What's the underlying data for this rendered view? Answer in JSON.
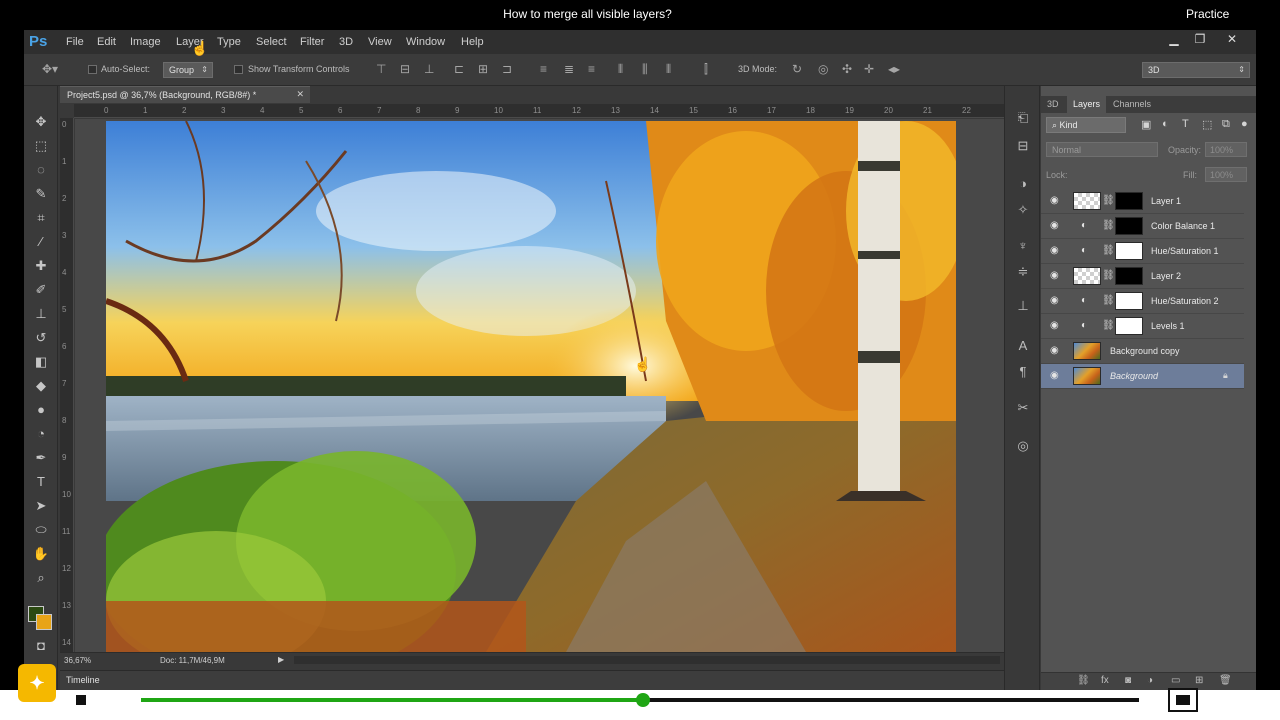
{
  "caption": {
    "title": "How to merge all visible layers?",
    "mode": "Practice"
  },
  "app": {
    "logo": "Ps",
    "menus": [
      "File",
      "Edit",
      "Image",
      "Layer",
      "Type",
      "Select",
      "Filter",
      "3D",
      "View",
      "Window",
      "Help"
    ],
    "window_controls": {
      "minimize": "▁",
      "restore": "❐",
      "close": "✕"
    }
  },
  "options": {
    "auto_select_label": "Auto-Select:",
    "auto_select_value": "Group",
    "show_transform_label": "Show Transform Controls",
    "mode_3d_label": "3D Mode:",
    "workspace_value": "3D"
  },
  "document": {
    "tab_title": "Project5.psd @ 36,7% (Background, RGB/8#) *",
    "zoom": "36,67%",
    "doc_size": "Doc: 11,7M/46,9M",
    "ruler_top_ticks": [
      "0",
      "1",
      "2",
      "3",
      "4",
      "5",
      "6",
      "7",
      "8",
      "9",
      "10",
      "11",
      "12",
      "13",
      "14",
      "15",
      "16",
      "17",
      "18",
      "19",
      "20",
      "21",
      "22"
    ],
    "ruler_left_ticks": [
      "0",
      "1",
      "2",
      "3",
      "4",
      "5",
      "6",
      "7",
      "8",
      "9",
      "10",
      "11",
      "12",
      "13",
      "14"
    ]
  },
  "timeline": {
    "label": "Timeline"
  },
  "panel": {
    "tabs": [
      "3D",
      "Layers",
      "Channels"
    ],
    "active_tab": "Layers",
    "filter_kind": "Kind",
    "blend_mode": "Normal",
    "opacity_label": "Opacity:",
    "opacity_value": "100%",
    "lock_label": "Lock:",
    "fill_label": "Fill:",
    "fill_value": "100%",
    "layers": [
      {
        "name": "Layer 1",
        "type": "pixel",
        "thumb": "checker",
        "mask": "black"
      },
      {
        "name": "Color Balance 1",
        "type": "adjustment",
        "mask": "black"
      },
      {
        "name": "Hue/Saturation 1",
        "type": "adjustment",
        "mask": "white"
      },
      {
        "name": "Layer 2",
        "type": "pixel",
        "thumb": "checker",
        "mask": "black"
      },
      {
        "name": "Hue/Saturation 2",
        "type": "adjustment",
        "mask": "white"
      },
      {
        "name": "Levels 1",
        "type": "adjustment",
        "mask": "white"
      },
      {
        "name": "Background copy",
        "type": "pixel",
        "thumb": "photo"
      },
      {
        "name": "Background",
        "type": "pixel",
        "thumb": "photo",
        "selected": true,
        "locked": true
      }
    ]
  },
  "player": {
    "progress": 0.503,
    "colors": {
      "played": "#1fa614",
      "track": "#111111"
    }
  },
  "colors": {
    "foreground": "#2c4a12",
    "background": "#e8a417",
    "selected_layer": "#6d7d9a",
    "ps_blue": "#4aa3e6"
  }
}
